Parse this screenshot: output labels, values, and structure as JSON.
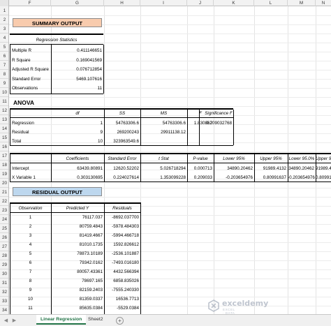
{
  "columns": [
    "F",
    "G",
    "H",
    "I",
    "J",
    "K",
    "L",
    "M",
    "N"
  ],
  "rows": [
    "1",
    "2",
    "3",
    "4",
    "5",
    "6",
    "7",
    "8",
    "9",
    "10",
    "11",
    "12",
    "13",
    "14",
    "15",
    "16",
    "17",
    "18",
    "19",
    "20",
    "21",
    "22",
    "23",
    "24",
    "25",
    "26",
    "27",
    "28",
    "29",
    "30",
    "31",
    "32",
    "33",
    "34"
  ],
  "summary": {
    "title": "SUMMARY OUTPUT",
    "reg_stats_header": "Regression Statistics",
    "stats": [
      {
        "label": "Multiple R",
        "value": "0.411146651"
      },
      {
        "label": "R Square",
        "value": "0.169041569"
      },
      {
        "label": "Adjusted R Square",
        "value": "0.076712854"
      },
      {
        "label": "Standard Error",
        "value": "5469.107616"
      },
      {
        "label": "Observations",
        "value": "11"
      }
    ]
  },
  "anova": {
    "title": "ANOVA",
    "headers": [
      "df",
      "SS",
      "MS",
      "F",
      "Significance F"
    ],
    "rows": [
      {
        "label": "Regression",
        "df": "1",
        "ss": "54763306.6",
        "ms": "54763306.6",
        "f": "1.830867",
        "sig": "0.209032768"
      },
      {
        "label": "Residual",
        "df": "9",
        "ss": "269200243",
        "ms": "29911138.12",
        "f": "",
        "sig": ""
      },
      {
        "label": "Total",
        "df": "10",
        "ss": "323963549.6",
        "ms": "",
        "f": "",
        "sig": ""
      }
    ]
  },
  "coef": {
    "headers": [
      "Coefficients",
      "Standard Error",
      "t Stat",
      "P-value",
      "Lower 95%",
      "Upper 95%",
      "Lower 95.0%",
      "Upper 95.0%"
    ],
    "rows": [
      {
        "label": "Intercept",
        "vals": [
          "63439.80891",
          "12620.52202",
          "5.026718294",
          "0.000713",
          "34890.20462",
          "91989.4132",
          "34890.20462",
          "91989.4132"
        ]
      },
      {
        "label": "X Variable 1",
        "vals": [
          "0.303130695",
          "0.224027614",
          "1.353099228",
          "0.209033",
          "-0.203654976",
          "0.80991637",
          "-0.203654976",
          "0.80991637"
        ]
      }
    ]
  },
  "residual": {
    "title": "RESIDUAL OUTPUT",
    "headers": [
      "Observation",
      "Predicted Y",
      "Residuals"
    ],
    "rows": [
      [
        "1",
        "76117.037",
        "-8692.037700"
      ],
      [
        "2",
        "80759.4843",
        "-5978.484303"
      ],
      [
        "3",
        "81419.4667",
        "-5994.466718"
      ],
      [
        "4",
        "81010.1735",
        "1592.826612"
      ],
      [
        "5",
        "78873.10189",
        "-2536.101887"
      ],
      [
        "6",
        "79342.0162",
        "-7493.016180"
      ],
      [
        "7",
        "80057.43361",
        "4432.566394"
      ],
      [
        "8",
        "78697.165",
        "6858.835026"
      ],
      [
        "9",
        "82159.2403",
        "-7555.240330"
      ],
      [
        "10",
        "81359.0337",
        "16536.7713"
      ],
      [
        "11",
        "85635.0384",
        "-5529.0384"
      ]
    ]
  },
  "sheet_tabs": {
    "active": "Linear Regression",
    "other": "Sheet2",
    "add": "+"
  },
  "watermark": {
    "name": "exceldemy",
    "tagline": "EXCEL · DATA · BI"
  },
  "colors": {
    "banner_orange": "#f8cbad",
    "banner_blue": "#bdd7ee",
    "tab_green": "#217346"
  }
}
